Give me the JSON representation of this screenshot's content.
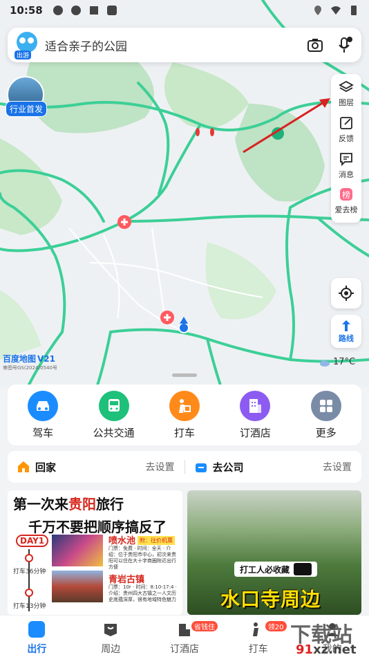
{
  "status": {
    "time": "10:58"
  },
  "search": {
    "query": "适合亲子的公园",
    "avatar_tag": "出游"
  },
  "promo": {
    "label": "行业首发"
  },
  "tools": [
    {
      "label": "图层",
      "icon": "layers-icon"
    },
    {
      "label": "反馈",
      "icon": "feedback-icon"
    },
    {
      "label": "消息",
      "icon": "message-icon"
    },
    {
      "label": "爱去榜",
      "icon": "ranking-icon"
    }
  ],
  "route": {
    "label": "路线"
  },
  "weather": {
    "temp": "17°C"
  },
  "map_logo": {
    "name": "百度地图",
    "badge": "V21",
    "license": "审图号GS(2024)0540号"
  },
  "quick_actions": [
    {
      "label": "驾车",
      "color": "#1a8cff",
      "icon": "car-icon"
    },
    {
      "label": "公共交通",
      "color": "#1ec07a",
      "icon": "bus-icon"
    },
    {
      "label": "打车",
      "color": "#ff8a1a",
      "icon": "taxi-icon"
    },
    {
      "label": "订酒店",
      "color": "#8c5cf2",
      "icon": "hotel-icon"
    },
    {
      "label": "更多",
      "color": "#7a8ba6",
      "icon": "grid-icon"
    }
  ],
  "places": {
    "home": {
      "label": "回家",
      "action": "去设置"
    },
    "company": {
      "label": "去公司",
      "action": "去设置"
    }
  },
  "card1": {
    "title_pre": "第一次来",
    "title_em": "贵阳",
    "title_post": "旅行",
    "subtitle": "千万不要把顺序搞反了",
    "day": "DAY1",
    "taxi1": "打车36分钟",
    "taxi2": "打车13分钟",
    "spot1": "喷水池",
    "spot1_badge": "附：往价机票",
    "spot1_info": "门票：免费 · 时间：全天 · 介绍：位于贵阳市中心，初次来贵阳可以住在大十字商圈附近出行方便",
    "spot2": "青岩古镇",
    "spot2_info": "门票：10r · 时间：8:10-17:4 · 介绍：贵州四大古镇之一人文历史底蕴深厚，很有地域特色魅力"
  },
  "card2": {
    "tag": "打工人必收藏",
    "title": "水口寺周边"
  },
  "tabs": [
    {
      "label": "出行",
      "active": true
    },
    {
      "label": "周边",
      "active": false
    },
    {
      "label": "订酒店",
      "active": false,
      "badge": "省钱住"
    },
    {
      "label": "打车",
      "active": false,
      "badge": "领20"
    },
    {
      "label": "我的",
      "active": false
    }
  ],
  "watermark": {
    "top": "下载站",
    "bottom_pre": "91",
    "bottom_post": "xz.net"
  }
}
